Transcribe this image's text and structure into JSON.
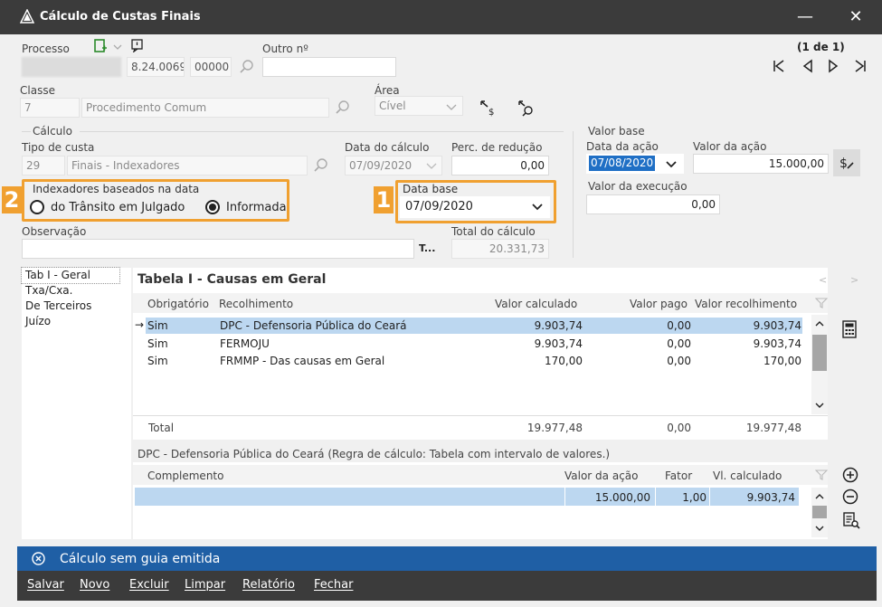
{
  "window": {
    "title": "Cálculo de Custas Finais",
    "minimize_glyph": "—",
    "close_glyph": "✕"
  },
  "processo": {
    "label": "Processo",
    "field_year": "8.24.0069",
    "field_foro": "00000",
    "outro_label": "Outro nº",
    "outro_value": ""
  },
  "nav": {
    "position": "(1 de 1)"
  },
  "classe": {
    "label": "Classe",
    "code": "7",
    "name": "Procedimento Comum"
  },
  "area": {
    "label": "Área",
    "value": "Cível"
  },
  "calculo": {
    "group_label": "Cálculo",
    "tipo_label": "Tipo de custa",
    "tipo_code": "29",
    "tipo_name": "Finais - Indexadores",
    "data_calculo_label": "Data do cálculo",
    "data_calculo_value": "07/09/2020",
    "perc_label": "Perc. de redução",
    "perc_value": "0,00",
    "indexadores_label": "Indexadores baseados na data",
    "radio_transito": "do Trânsito em Julgado",
    "radio_informada": "Informada",
    "data_base_label": "Data base",
    "data_base_value": "07/09/2020",
    "observacao_label": "Observação",
    "observacao_value": "",
    "text_button": "T...",
    "total_label": "Total do cálculo",
    "total_value": "20.331,73"
  },
  "valor_base": {
    "group_label": "Valor base",
    "data_acao_label": "Data da ação",
    "data_acao_value": "07/08/2020",
    "valor_acao_label": "Valor da ação",
    "valor_acao_value": "15.000,00",
    "valor_exec_label": "Valor da execução",
    "valor_exec_value": "0,00"
  },
  "badges": {
    "one": "1",
    "two": "2"
  },
  "tabs": [
    {
      "label": "Tab I - Geral",
      "selected": true
    },
    {
      "label": "Txa/Cxa."
    },
    {
      "label": "De Terceiros"
    },
    {
      "label": "Juízo"
    }
  ],
  "tabela": {
    "title": "Tabela I - Causas em Geral",
    "prev": "<",
    "next": ">",
    "headers": [
      "Obrigatório",
      "Recolhimento",
      "Valor calculado",
      "Valor pago",
      "Valor recolhimento"
    ],
    "rows": [
      {
        "obrig": "Sim",
        "recolh": "DPC - Defensoria Pública do Ceará",
        "calc": "9.903,74",
        "pago": "0,00",
        "recval": "9.903,74",
        "selected": true
      },
      {
        "obrig": "Sim",
        "recolh": "FERMOJU",
        "calc": "9.903,74",
        "pago": "0,00",
        "recval": "9.903,74"
      },
      {
        "obrig": "Sim",
        "recolh": "FRMMP - Das causas em Geral",
        "calc": "170,00",
        "pago": "0,00",
        "recval": "170,00"
      }
    ],
    "total_label": "Total",
    "total_calc": "19.977,48",
    "total_pago": "0,00",
    "total_recval": "19.977,48"
  },
  "detalhe": {
    "caption": "DPC - Defensoria Pública do Ceará (Regra de cálculo: Tabela com intervalo de valores.)",
    "headers": [
      "Complemento",
      "Valor da ação",
      "Fator",
      "Vl. calculado"
    ],
    "row": {
      "complemento": "",
      "valor_acao": "15.000,00",
      "fator": "1,00",
      "vl_calc": "9.903,74"
    }
  },
  "status": {
    "text": "Cálculo sem guia emitida"
  },
  "footer": [
    "Salvar",
    "Novo",
    "Excluir",
    "Limpar",
    "Relatório",
    "Fechar"
  ],
  "colors": {
    "titlebar": "#3b3b3b",
    "status": "#1f5fa5",
    "highlight": "#f0a030",
    "selection": "#bcd7f0"
  }
}
